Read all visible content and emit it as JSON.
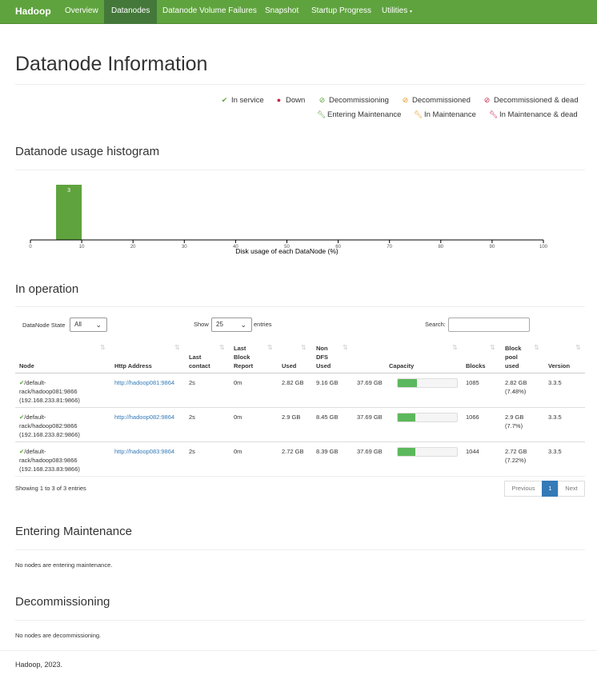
{
  "navbar": {
    "brand": "Hadoop",
    "items": [
      {
        "label": "Overview"
      },
      {
        "label": "Datanodes"
      },
      {
        "label": "Datanode Volume Failures"
      },
      {
        "label": "Snapshot"
      },
      {
        "label": "Startup Progress"
      },
      {
        "label": "Utilities"
      }
    ]
  },
  "page_title": "Datanode Information",
  "legend": {
    "in_service": "In service",
    "down": "Down",
    "decommissioning": "Decommissioning",
    "decommissioned": "Decommissioned",
    "decommissioned_dead": "Decommissioned & dead",
    "entering_maintenance": "Entering Maintenance",
    "in_maintenance": "In Maintenance",
    "in_maintenance_dead": "In Maintenance & dead"
  },
  "histogram": {
    "title": "Datanode usage histogram"
  },
  "chart_data": {
    "type": "bar",
    "xlabel": "Disk usage of each DataNode (%)",
    "xlim": [
      0,
      100
    ],
    "x_ticks": [
      0,
      10,
      20,
      30,
      40,
      50,
      60,
      70,
      80,
      90,
      100
    ],
    "bins": [
      {
        "from": 5,
        "to": 10,
        "count": 3
      }
    ],
    "bar_color": "#5fa33e"
  },
  "in_operation": {
    "title": "In operation",
    "state_label": "DataNode State",
    "state_value": "All",
    "show_label": "Show",
    "show_value": "25",
    "entries_label": "entries",
    "search_label": "Search:",
    "headers": [
      "Node",
      "Http Address",
      "Last contact",
      "Last Block Report",
      "Used",
      "Non DFS Used",
      "Capacity",
      "Blocks",
      "Block pool used",
      "Version"
    ],
    "rows": [
      {
        "node_1": "/default-",
        "node_2": "rack/hadoop081:9866",
        "node_3": "(192.168.233.81:9866)",
        "http": "http://hadoop081:9864",
        "last_contact": "2s",
        "last_block": "0m",
        "used": "2.82 GB",
        "non_dfs": "9.16 GB",
        "capacity": "37.69 GB",
        "used_fraction": 0.32,
        "blocks": "1085",
        "bp_1": "2.82 GB",
        "bp_2": "(7.48%)",
        "version": "3.3.5"
      },
      {
        "node_1": "/default-",
        "node_2": "rack/hadoop082:9866",
        "node_3": "(192.168.233.82:9866)",
        "http": "http://hadoop082:9864",
        "last_contact": "2s",
        "last_block": "0m",
        "used": "2.9 GB",
        "non_dfs": "8.45 GB",
        "capacity": "37.69 GB",
        "used_fraction": 0.3,
        "blocks": "1066",
        "bp_1": "2.9 GB",
        "bp_2": "(7.7%)",
        "version": "3.3.5"
      },
      {
        "node_1": "/default-",
        "node_2": "rack/hadoop083:9866",
        "node_3": "(192.168.233.83:9866)",
        "http": "http://hadoop083:9864",
        "last_contact": "2s",
        "last_block": "0m",
        "used": "2.72 GB",
        "non_dfs": "8.39 GB",
        "capacity": "37.69 GB",
        "used_fraction": 0.3,
        "blocks": "1044",
        "bp_1": "2.72 GB",
        "bp_2": "(7.22%)",
        "version": "3.3.5"
      }
    ],
    "showing_text": "Showing 1 to 3 of 3 entries",
    "pagination": {
      "previous": "Previous",
      "page": "1",
      "next": "Next"
    }
  },
  "entering_maintenance": {
    "title": "Entering Maintenance",
    "message": "No nodes are entering maintenance."
  },
  "decommissioning": {
    "title": "Decommissioning",
    "message": "No nodes are decommissioning."
  },
  "footer": "Hadoop, 2023."
}
